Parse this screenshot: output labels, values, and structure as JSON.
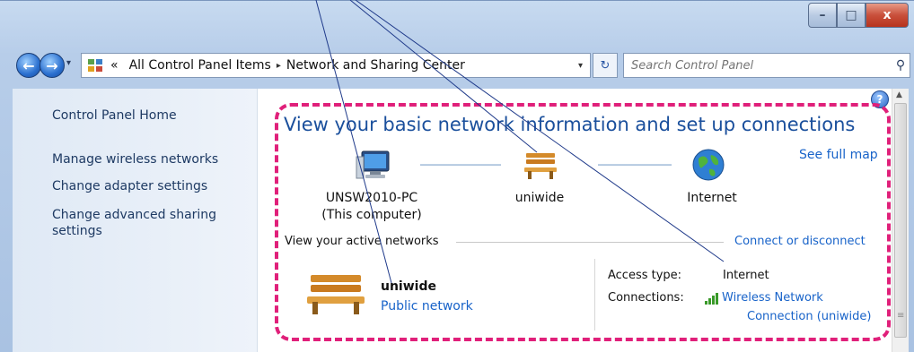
{
  "window": {
    "controls": {
      "minimize": "–",
      "maximize": "□",
      "close": "x"
    }
  },
  "navbar": {
    "back": "←",
    "forward": "→",
    "dropdown": "▾",
    "overflow": "«",
    "breadcrumbs": [
      "All Control Panel Items",
      "Network and Sharing Center"
    ],
    "separator": "▸",
    "address_dropdown": "▾",
    "refresh": "↻",
    "search_placeholder": "Search Control Panel",
    "search_icon": "⚲"
  },
  "sidebar": {
    "items": [
      {
        "label": "Control Panel Home"
      },
      {
        "label": "Manage wireless networks"
      },
      {
        "label": "Change adapter settings"
      },
      {
        "label": "Change advanced sharing"
      },
      {
        "label": "settings"
      }
    ]
  },
  "main": {
    "heading": "View your basic network information and set up connections",
    "see_full_map": "See full map",
    "nodes": [
      {
        "name": "UNSW2010-PC",
        "sub": "(This computer)",
        "icon": "computer-icon"
      },
      {
        "name": "uniwide",
        "icon": "bench-icon"
      },
      {
        "name": "Internet",
        "icon": "globe-icon"
      }
    ],
    "active_networks_label": "View your active networks",
    "connect_disconnect": "Connect or disconnect",
    "active_network": {
      "name": "uniwide",
      "type": "Public network",
      "access_type_label": "Access type:",
      "access_type_value": "Internet",
      "connections_label": "Connections:",
      "connection_link_line1": "Wireless Network",
      "connection_link_line2": "Connection (uniwide)"
    }
  },
  "colors": {
    "highlight_dash": "#e0207a",
    "link": "#1863c9",
    "heading": "#1a4f9c",
    "annotation_lines": "#1f3a8a"
  }
}
